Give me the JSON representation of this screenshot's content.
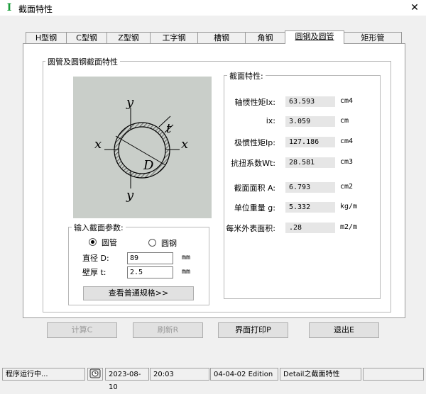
{
  "window": {
    "title": "截面特性",
    "app_icon": "I-beam-icon",
    "close_label": "✕"
  },
  "tabs": [
    {
      "label": "H型钢"
    },
    {
      "label": "C型钢"
    },
    {
      "label": "Z型钢"
    },
    {
      "label": "工字钢"
    },
    {
      "label": "槽钢"
    },
    {
      "label": "角钢"
    },
    {
      "label": "圆钢及圆管",
      "active": true
    },
    {
      "label": "矩形管"
    }
  ],
  "main_group": {
    "label": "圆管及圆钢截面特性"
  },
  "figure": {
    "label_y": "y",
    "label_x": "x",
    "label_t": "t",
    "label_D": "D",
    "background": "#c9cec9"
  },
  "properties": {
    "label": "截面特性:",
    "rows": [
      {
        "label": "轴惯性矩Ix:",
        "value": "63.593",
        "unit": "cm4"
      },
      {
        "label": "ix:",
        "value": "3.059",
        "unit": "cm"
      },
      {
        "label": "极惯性矩Ip:",
        "value": "127.186",
        "unit": "cm4"
      },
      {
        "label": "抗扭系数Wt:",
        "value": "28.581",
        "unit": "cm3"
      },
      {
        "label": "截面面积 A:",
        "value": "6.793",
        "unit": "cm2"
      },
      {
        "label": "单位重量 g:",
        "value": "5.332",
        "unit": "kg/m"
      },
      {
        "label": "每米外表面积:",
        "value": ".28",
        "unit": "m2/m"
      }
    ]
  },
  "input": {
    "label": "输入截面参数:",
    "radio_tube": "圆管",
    "radio_bar": "圆钢",
    "selected": "圆管",
    "diameter_label": "直径 D:",
    "diameter_value": "89",
    "diameter_unit": "mm",
    "thickness_label": "壁厚 t:",
    "thickness_value": "2.5",
    "thickness_unit": "mm",
    "spec_button": "查看普通规格>>"
  },
  "buttons": {
    "calc": "计算C",
    "refresh": "刷新R",
    "print": "界面打印P",
    "exit": "退出E"
  },
  "status": {
    "running": "程序运行中...",
    "date": "2023-08-10",
    "time": "20:03",
    "edition": "04-04-02 Edition",
    "detail": "Detail之截面特性"
  }
}
